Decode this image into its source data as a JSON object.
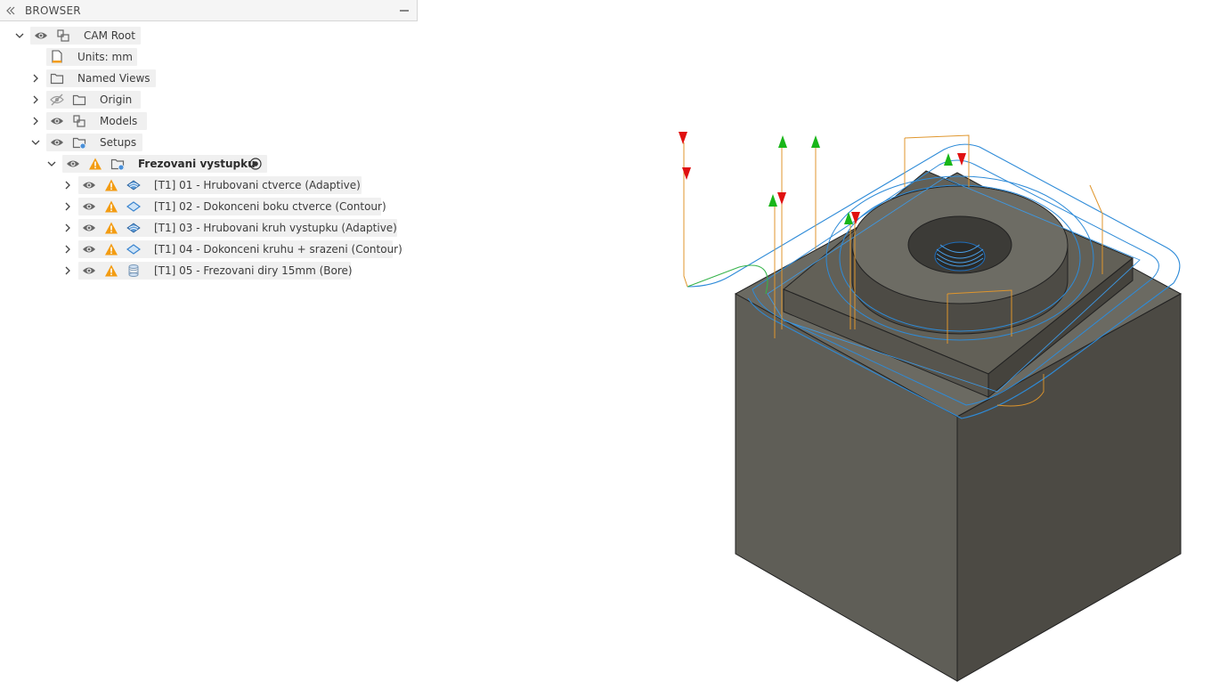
{
  "browser": {
    "title": "BROWSER"
  },
  "tree": {
    "root": {
      "label": "CAM Root"
    },
    "units": {
      "label": "Units: mm"
    },
    "named_views": {
      "label": "Named Views"
    },
    "origin": {
      "label": "Origin"
    },
    "models": {
      "label": "Models"
    },
    "setups": {
      "label": "Setups"
    },
    "setup": {
      "label": "Frezovani vystupku"
    },
    "operations": [
      {
        "label": "[T1] 01 - Hrubovani ctverce (Adaptive)",
        "icon": "adaptive-icon"
      },
      {
        "label": "[T1] 02 - Dokonceni boku ctverce (Contour)",
        "icon": "contour-icon"
      },
      {
        "label": "[T1] 03 - Hrubovani kruh vystupku (Adaptive)",
        "icon": "adaptive-icon"
      },
      {
        "label": "[T1] 04 - Dokonceni kruhu + srazeni (Contour)",
        "icon": "contour-icon"
      },
      {
        "label": "[T1] 05 - Frezovani diry 15mm (Bore)",
        "icon": "bore-icon"
      }
    ]
  },
  "colors": {
    "warning": "#f39c12",
    "toolpath_blue": "#2e8bd8",
    "toolpath_orange": "#e0962c",
    "toolpath_green": "#35b34a",
    "arrow_red": "#e01010",
    "arrow_green": "#19b619",
    "stock_dark": "#4a4842",
    "stock_mid": "#6b6a62"
  }
}
